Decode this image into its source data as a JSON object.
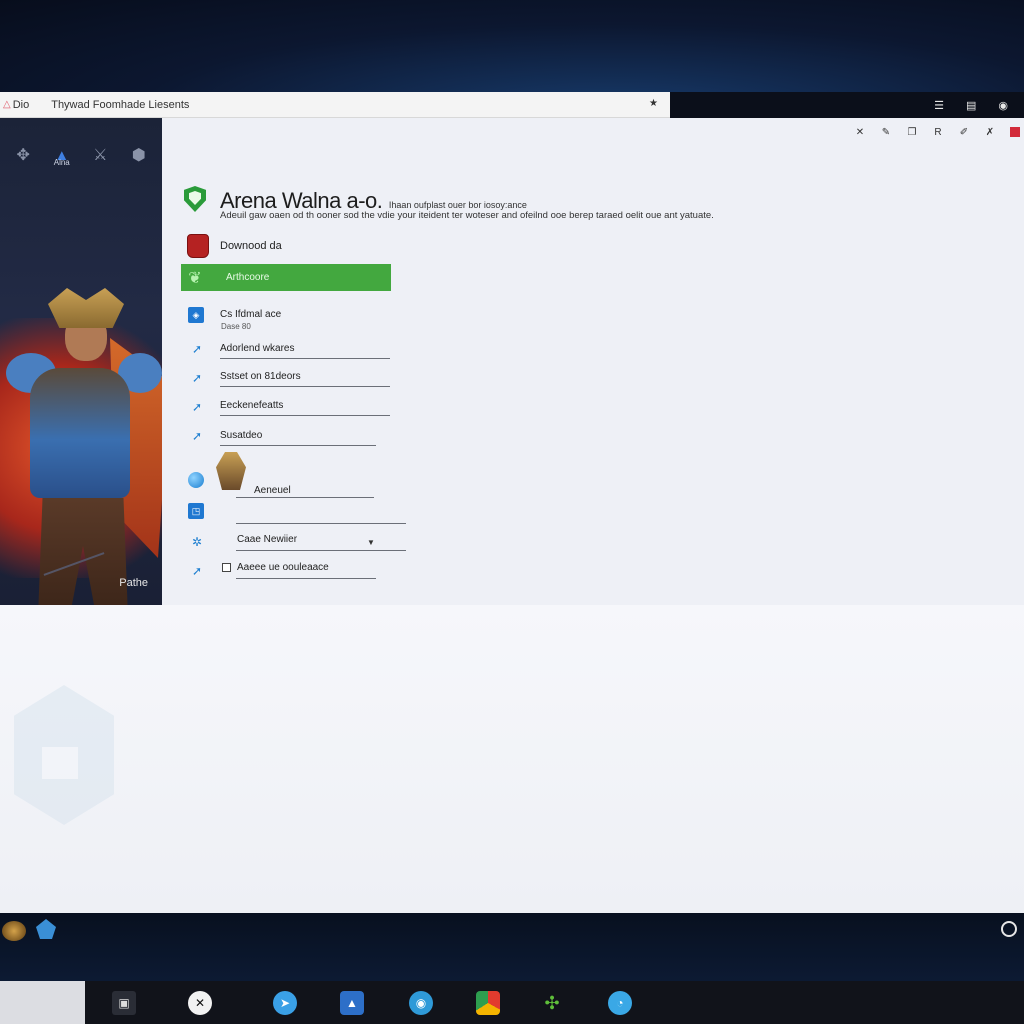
{
  "window": {
    "app_mark": "△",
    "app_name": "Dio",
    "title": "Thywad  Foomhade Liesents",
    "pin_icon": "star-icon"
  },
  "darkbar": {
    "icons": [
      "list-icon",
      "grid-icon",
      "eye-icon"
    ]
  },
  "art_panel": {
    "top_icon_label": "Alna",
    "footer_label": "Pathe"
  },
  "main": {
    "heading_big": "Arena Walna a-o.",
    "heading_small": "Ihaan oufplast ouer bor iosoy:ance",
    "subtitle": "Adeuil gaw oaen od th ooner sod the vdie your iteident ter woteser and ofeilnd ooe berep taraed oelit oue ant yatuate.",
    "download_label": "Downood da",
    "green_button_label": "Arthcoore",
    "rows": [
      {
        "label": "Cs Ifdmal ace",
        "note": "Dase 80"
      },
      {
        "label": "Adorlend wkares"
      },
      {
        "label": "Sstset on 81deors"
      },
      {
        "label": "Eeckenefeatts"
      },
      {
        "label": "Susatdeo"
      },
      {
        "label": "Aeneuel"
      },
      {
        "label": ""
      },
      {
        "label": "Caae Newiier"
      },
      {
        "label": "Aaeee ue oouleaace"
      }
    ]
  },
  "taskbar": {
    "icons": [
      "window-icon",
      "x-icon",
      "bird-icon",
      "photo-icon",
      "browser-icon",
      "chrome-icon",
      "tree-icon",
      "chat-icon"
    ]
  }
}
